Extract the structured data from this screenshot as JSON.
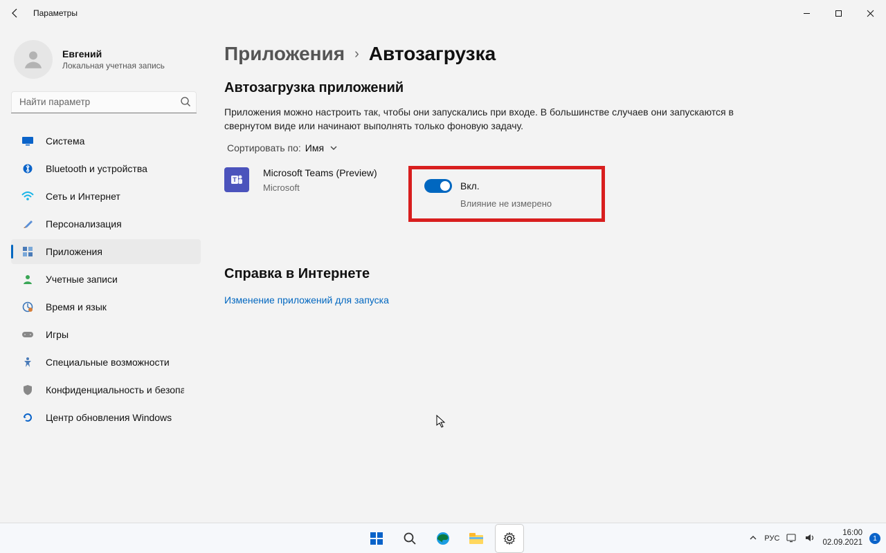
{
  "titlebar": {
    "title": "Параметры"
  },
  "user": {
    "name": "Евгений",
    "type": "Локальная учетная запись"
  },
  "search": {
    "placeholder": "Найти параметр"
  },
  "nav": {
    "items": [
      {
        "label": "Система"
      },
      {
        "label": "Bluetooth и устройства"
      },
      {
        "label": "Сеть и Интернет"
      },
      {
        "label": "Персонализация"
      },
      {
        "label": "Приложения"
      },
      {
        "label": "Учетные записи"
      },
      {
        "label": "Время и язык"
      },
      {
        "label": "Игры"
      },
      {
        "label": "Специальные возможности"
      },
      {
        "label": "Конфиденциальность и безопасность"
      },
      {
        "label": "Центр обновления Windows"
      }
    ]
  },
  "breadcrumb": {
    "parent": "Приложения",
    "current": "Автозагрузка"
  },
  "section": {
    "heading": "Автозагрузка приложений",
    "description": "Приложения можно настроить так, чтобы они запускались при входе. В большинстве случаев они запускаются в свернутом виде или начинают выполнять только фоновую задачу.",
    "sort_label": "Сортировать по:",
    "sort_value": "Имя"
  },
  "app": {
    "name": "Microsoft Teams (Preview)",
    "publisher": "Microsoft",
    "toggle_label": "Вкл.",
    "impact": "Влияние не измерено"
  },
  "help": {
    "heading": "Справка в Интернете",
    "link": "Изменение приложений для запуска"
  },
  "taskbar": {
    "lang": "РУС",
    "time": "16:00",
    "date": "02.09.2021",
    "badge": "1"
  }
}
